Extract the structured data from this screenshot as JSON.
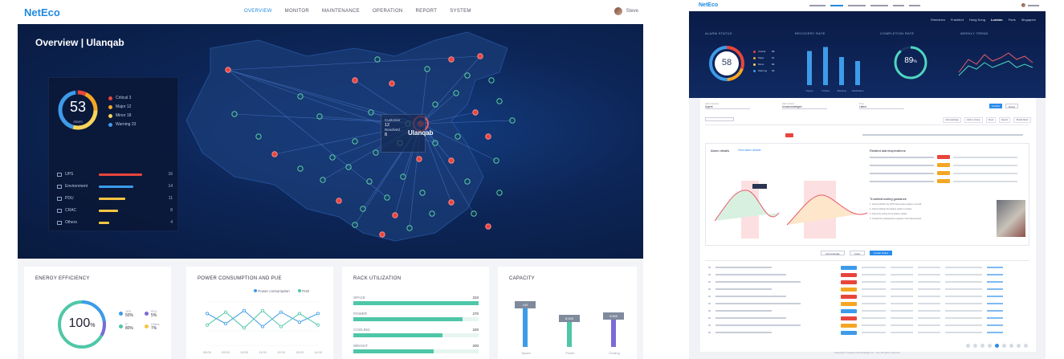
{
  "left": {
    "logo": "NetEco",
    "nav": [
      "MONITOR",
      "MAINTENANCE",
      "OPERATION",
      "REPORT",
      "SYSTEM"
    ],
    "nav_active": "OVERVIEW",
    "user_name": "Steve",
    "hero_title": "Overview | Ulanqab",
    "alarm_summary": {
      "total": "53",
      "sub_label": "Alarm",
      "legend": [
        {
          "label": "Critical 3",
          "color": "#e8453c"
        },
        {
          "label": "Major 12",
          "color": "#f5a623"
        },
        {
          "label": "Minor 18",
          "color": "#f8d55a"
        },
        {
          "label": "Warning 23",
          "color": "#3d9be9"
        }
      ],
      "categories": [
        {
          "label": "UPS",
          "count": "16",
          "fill": 0.9,
          "color": "#e8453c"
        },
        {
          "label": "Environment",
          "count": "14",
          "fill": 0.72,
          "color": "#3d9be9"
        },
        {
          "label": "PDU",
          "count": "11",
          "fill": 0.55,
          "color": "#f5c542"
        },
        {
          "label": "CRAC",
          "count": "8",
          "fill": 0.4,
          "color": "#f5c542"
        },
        {
          "label": "Others",
          "count": "4",
          "fill": 0.22,
          "color": "#f5c542"
        }
      ]
    },
    "map_tooltip": {
      "line1": "Customer",
      "value1": "12",
      "line2": "Resolved",
      "value2": "8"
    },
    "map_label": "Ulanqab",
    "cards": {
      "energy": {
        "title": "ENERGY EFFICIENCY",
        "value": "100",
        "unit": "%",
        "legend": [
          {
            "label": "UPS",
            "value": "50%",
            "color": "#3d9be9"
          },
          {
            "label": "PDU",
            "value": "5%",
            "color": "#7a6bd8"
          },
          {
            "label": "IT",
            "value": "80%",
            "color": "#4ec7a8"
          },
          {
            "label": "Others",
            "value": "7%",
            "color": "#f5c542"
          }
        ]
      },
      "power": {
        "title": "POWER CONSUMPTION AND PUE",
        "legend": [
          "Power consumption",
          "PUE"
        ],
        "colors": [
          "#3d9be9",
          "#4ec7a8"
        ],
        "x_labels": [
          "08:00",
          "09:00",
          "10:00",
          "11:00",
          "12:00",
          "13:00",
          "14:00"
        ],
        "chart_data": {
          "type": "line",
          "x": [
            "08:00",
            "09:00",
            "10:00",
            "11:00",
            "12:00",
            "13:00",
            "14:00"
          ],
          "series": [
            {
              "name": "Power consumption",
              "values": [
                2.2,
                1.5,
                2.4,
                1.3,
                2.3,
                1.6,
                2.2
              ]
            },
            {
              "name": "PUE",
              "values": [
                1.4,
                2.3,
                1.2,
                2.4,
                1.3,
                2.2,
                1.4
              ]
            }
          ],
          "ylim": [
            0,
            3
          ]
        }
      },
      "rack": {
        "title": "RACK UTILIZATION",
        "rows": [
          {
            "label": "SPACE",
            "value": "310",
            "fill": 1.0
          },
          {
            "label": "POWER",
            "value": "270",
            "fill": 0.87
          },
          {
            "label": "COOLING",
            "value": "220",
            "fill": 0.71
          },
          {
            "label": "WEIGHT",
            "value": "200",
            "fill": 0.64
          }
        ]
      },
      "capacity": {
        "title": "CAPACITY",
        "columns": [
          {
            "label": "Space",
            "badge": "100",
            "fill": 0.85,
            "color": "#3d9be9"
          },
          {
            "label": "Power",
            "badge": "8,000",
            "fill": 0.55,
            "color": "#4ec7a8"
          },
          {
            "label": "Cooling",
            "badge": "9,500",
            "fill": 0.6,
            "color": "#7a6bd8"
          }
        ]
      }
    }
  },
  "right": {
    "logo": "NetEco",
    "tabs": [
      "Shenzhen",
      "Frankfurt",
      "Hong Kong",
      "London",
      "Paris",
      "Singapore"
    ],
    "tab_active": "London",
    "sections": {
      "alarm": {
        "title": "ALARM STATUS",
        "value": "58",
        "legend": [
          "Critical",
          "Major",
          "Minor",
          "Warning"
        ],
        "counts": [
          "18",
          "11",
          "16",
          "13"
        ]
      },
      "recovery": {
        "title": "RECOVERY RATE",
        "chart_data": {
          "type": "bar",
          "categories": [
            "Urgent",
            "Critical",
            "Warning",
            "Notification"
          ],
          "values": [
            85,
            95,
            70,
            60
          ],
          "ylim": [
            0,
            100
          ]
        }
      },
      "completion": {
        "title": "COMPLETION RATE",
        "value": "89",
        "unit": "%",
        "fill": 0.89
      },
      "trend": {
        "title": "WEEKLY TREND"
      }
    },
    "filters": [
      {
        "label": "Alarm Severity",
        "value": "Urgent"
      },
      {
        "label": "Alarm Status",
        "value": "Unacknowledged"
      },
      {
        "label": "Time",
        "value": "Latest"
      }
    ],
    "action_buttons": [
      "Confirm",
      "Reset"
    ],
    "tool_buttons": [
      "Acknowledge",
      "Add to Group",
      "Clear",
      "Export",
      "Shield Alarm"
    ],
    "detail": {
      "title": "Alarm details",
      "link": "View alarm details",
      "related_title": "Related alarm/operations",
      "guide_title": "Troubleshooting guidance",
      "guide_lines": [
        "1. Check whether the UPS input power supply is normal.",
        "2. Check whether the battery switch is closed.",
        "3. Check the wiring of the battery cables.",
        "4. Contact the maintenance engineer if the fault persists."
      ]
    },
    "bottom_buttons": [
      "Acknowledge",
      "Clear",
      "Create Ticket"
    ],
    "rows": 10,
    "footer": "Copyright © Huawei Technologies Co., Ltd. All rights reserved."
  }
}
